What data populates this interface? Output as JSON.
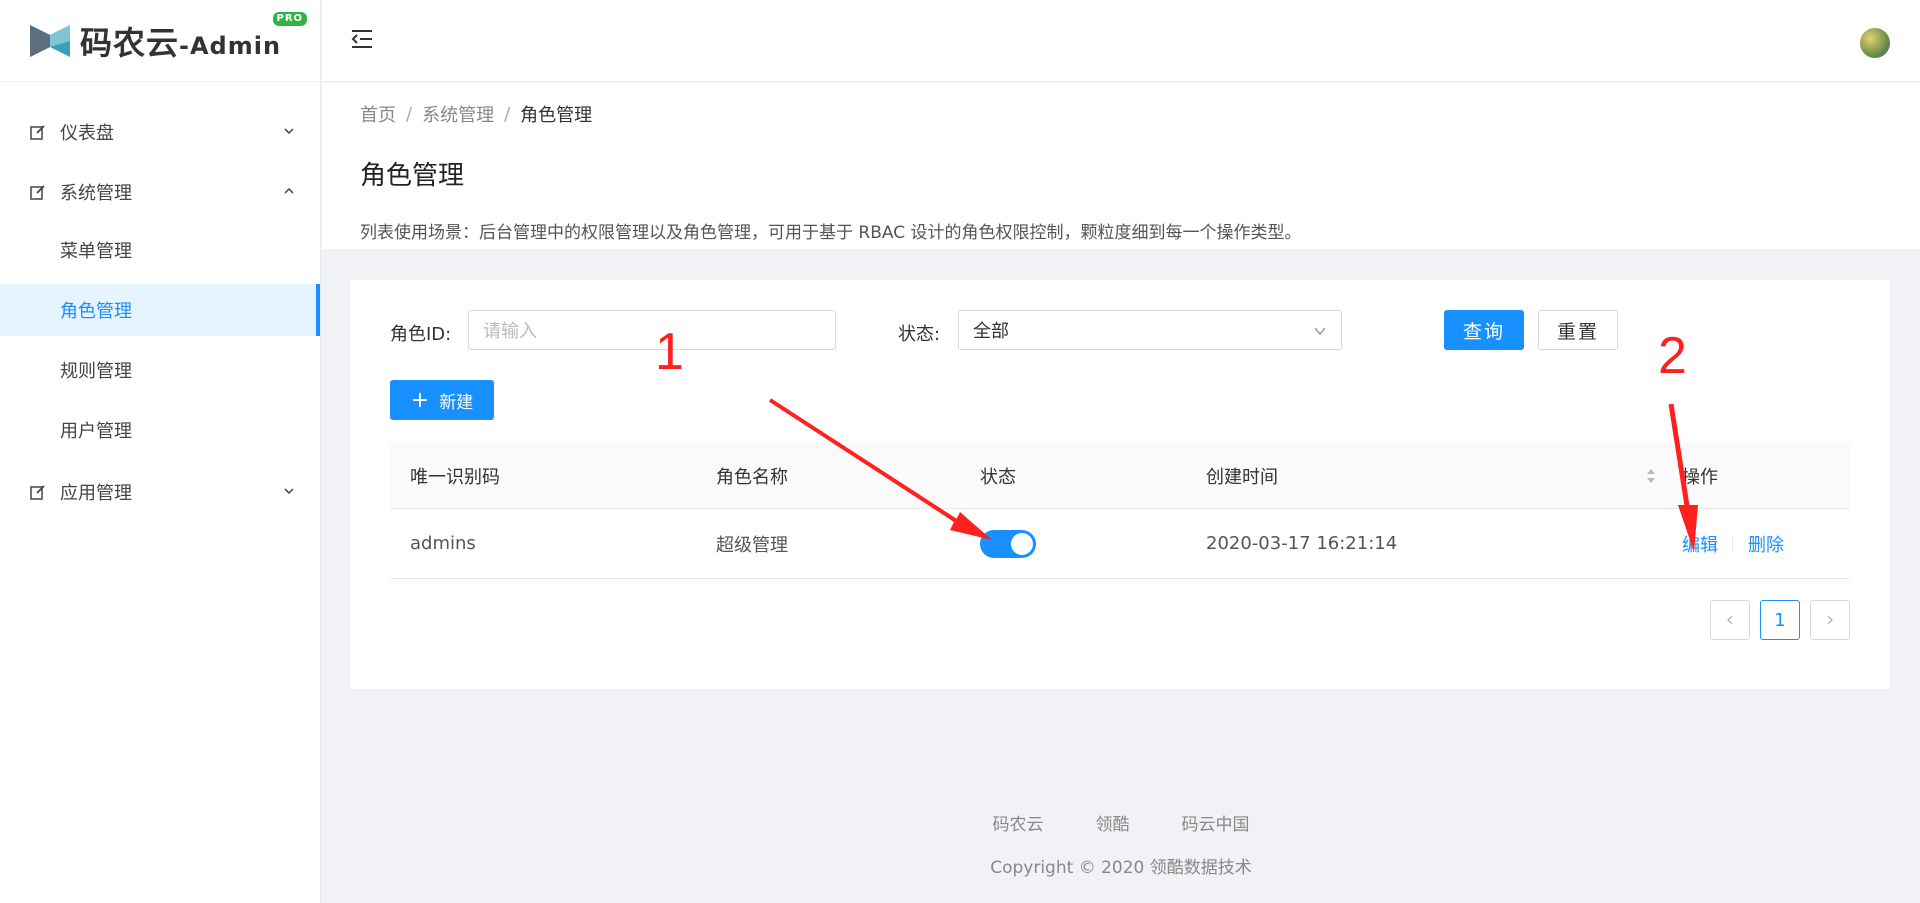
{
  "app": {
    "logo_text": "码农云",
    "logo_suffix": "-Admin",
    "pro_badge": "PRO"
  },
  "sidebar": {
    "items": [
      {
        "label": "仪表盘",
        "icon": "edit-icon",
        "expanded": false
      },
      {
        "label": "系统管理",
        "icon": "edit-icon",
        "expanded": true
      },
      {
        "label": "应用管理",
        "icon": "edit-icon",
        "expanded": false
      }
    ],
    "sub_items": [
      {
        "label": "菜单管理",
        "active": false
      },
      {
        "label": "角色管理",
        "active": true
      },
      {
        "label": "规则管理",
        "active": false
      },
      {
        "label": "用户管理",
        "active": false
      }
    ]
  },
  "breadcrumb": [
    "首页",
    "系统管理",
    "角色管理"
  ],
  "page": {
    "title": "角色管理",
    "description": "列表使用场景：后台管理中的权限管理以及角色管理，可用于基于 RBAC 设计的角色权限控制，颗粒度细到每一个操作类型。"
  },
  "filters": {
    "role_id_label": "角色ID:",
    "role_id_placeholder": "请输入",
    "status_label": "状态:",
    "status_value": "全部",
    "query_button": "查询",
    "reset_button": "重置",
    "new_button": "新建"
  },
  "table": {
    "columns": [
      "唯一识别码",
      "角色名称",
      "状态",
      "创建时间",
      "操作"
    ],
    "rows": [
      {
        "code": "admins",
        "name": "超级管理",
        "status_on": true,
        "created": "2020-03-17 16:21:14",
        "edit": "编辑",
        "delete": "删除"
      }
    ]
  },
  "pagination": {
    "current": "1"
  },
  "footer": {
    "links": [
      "码农云",
      "领酷",
      "码云中国"
    ],
    "copyright": "Copyright © 2020 领酷数据技术"
  },
  "annotations": {
    "label_1": "1",
    "label_2": "2"
  },
  "colors": {
    "primary": "#1890ff",
    "annotation": "#ff2020",
    "pro_badge": "#2fb344"
  }
}
